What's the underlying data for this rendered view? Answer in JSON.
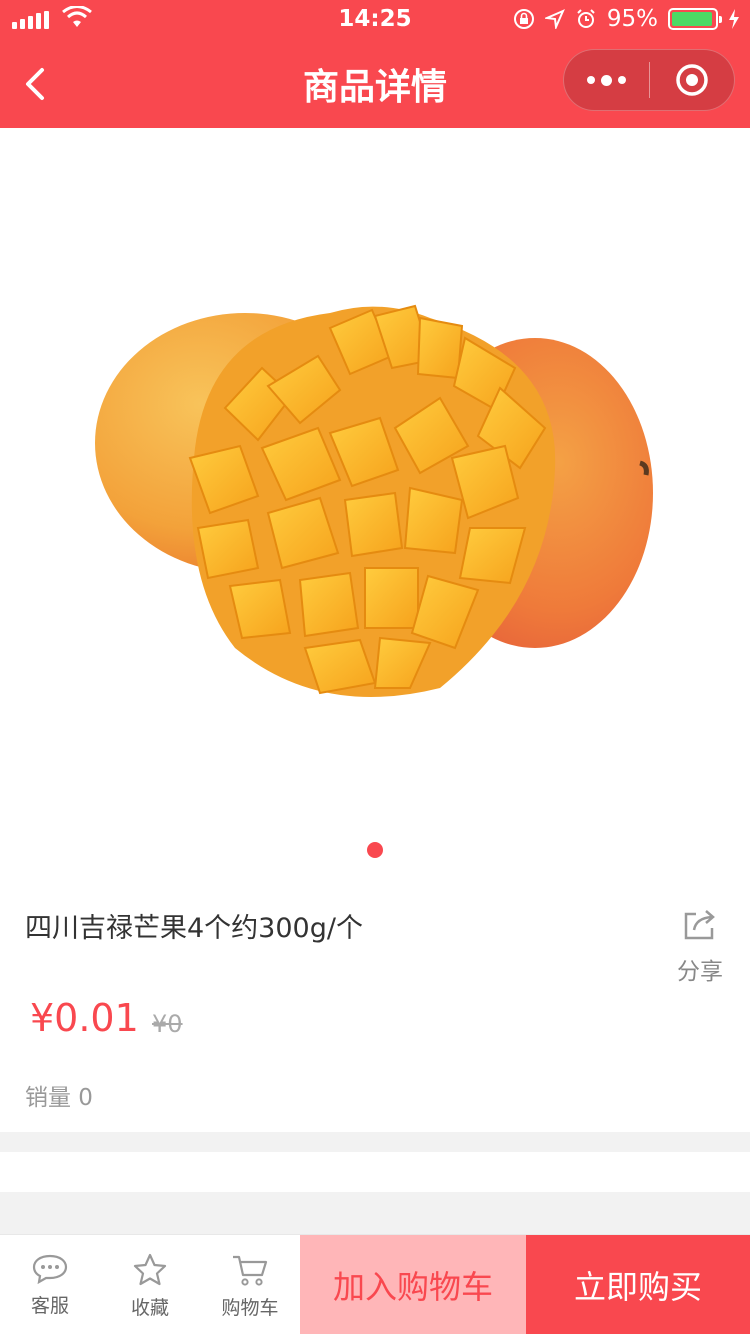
{
  "status_bar": {
    "time": "14:25",
    "battery_text": "95%",
    "battery_level": 0.95
  },
  "nav": {
    "title": "商品详情"
  },
  "product": {
    "title": "四川吉禄芒果4个约300g/个",
    "price": "¥0.01",
    "original_price": "¥0",
    "sales": "销量 0",
    "share_label": "分享"
  },
  "bottom_bar": {
    "service_label": "客服",
    "favorite_label": "收藏",
    "cart_label": "购物车",
    "add_to_cart": "加入购物车",
    "buy_now": "立即购买"
  },
  "colors": {
    "brand": "#f9484f",
    "add_to_cart_bg": "#ffb6b8",
    "battery": "#4cd964"
  },
  "icons": [
    "back-arrow-icon",
    "more-dots-icon",
    "close-target-icon",
    "share-icon",
    "chat-bubble-icon",
    "star-icon",
    "cart-icon"
  ]
}
